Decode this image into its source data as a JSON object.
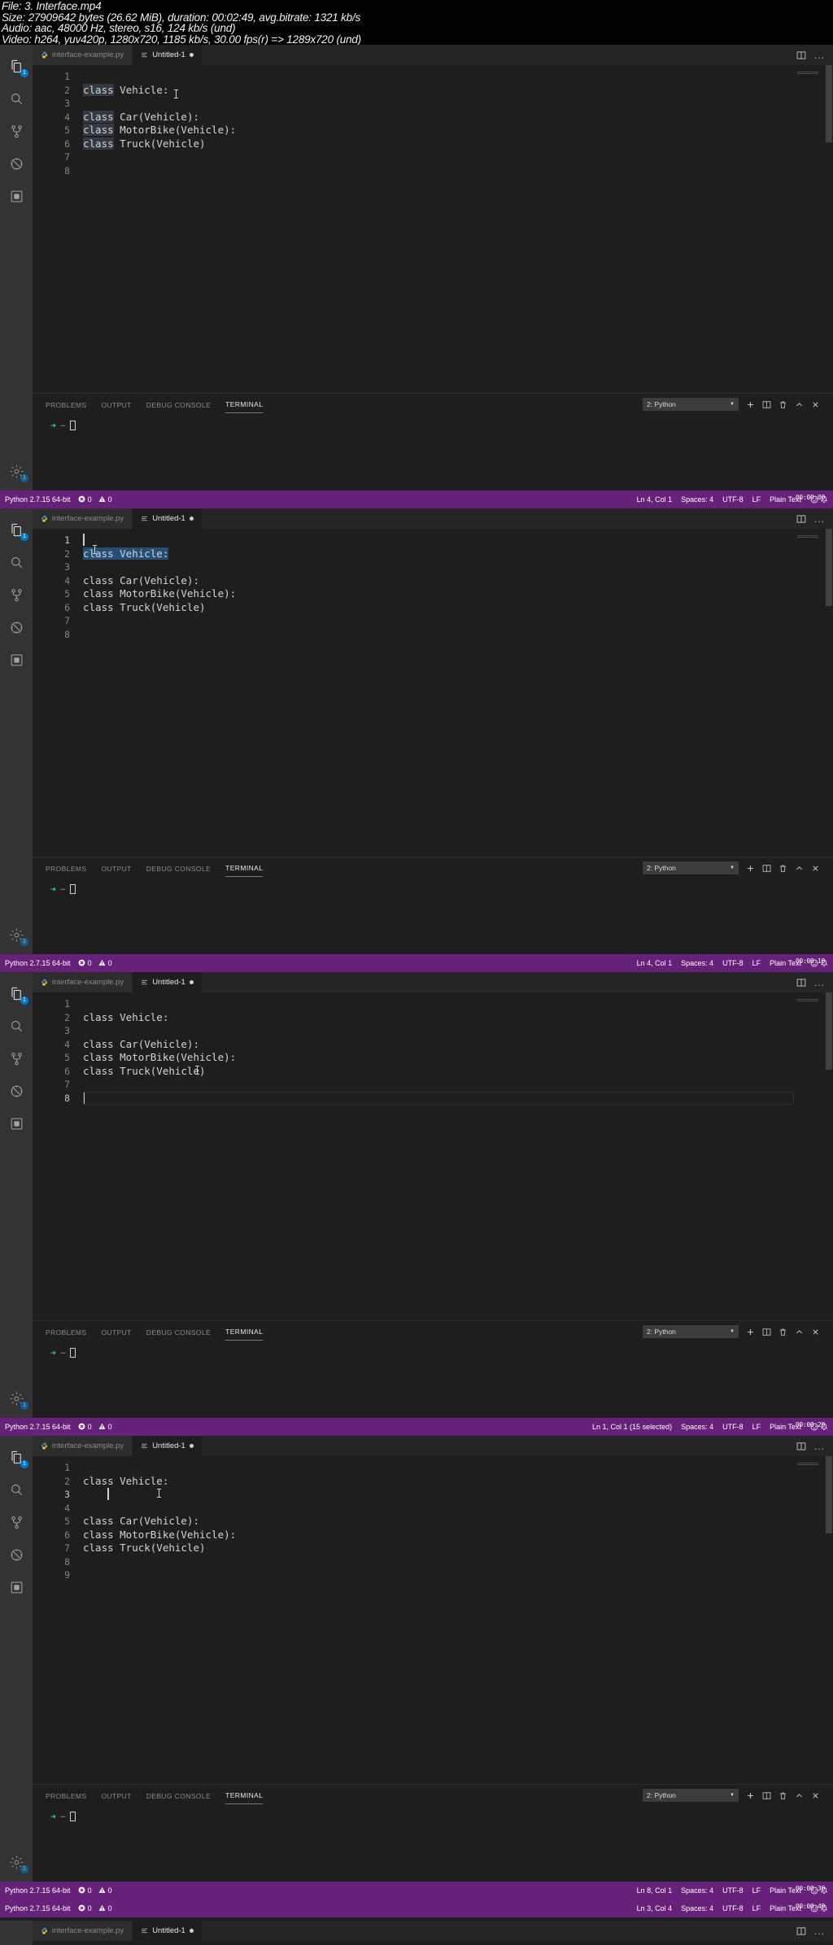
{
  "header": {
    "lines": [
      "File: 3. Interface.mp4",
      "Size: 27909642 bytes (26.62 MiB), duration: 00:02:49, avg.bitrate: 1321 kb/s",
      "Audio: aac, 48000 Hz, stereo, s16, 124 kb/s (und)",
      "Video: h264, yuv420p, 1280x720, 1185 kb/s, 30.00 fps(r) => 1289x720 (und)"
    ]
  },
  "activity_bar": {
    "items": [
      {
        "name": "explorer-icon",
        "badge": "1"
      },
      {
        "name": "search-icon",
        "badge": ""
      },
      {
        "name": "source-control-icon",
        "badge": ""
      },
      {
        "name": "run-debug-icon",
        "badge": ""
      },
      {
        "name": "extensions-icon",
        "badge": ""
      }
    ],
    "bottom": {
      "name": "settings-gear-icon",
      "badge": "1"
    }
  },
  "tabs": [
    {
      "label": "interface-example.py",
      "icon": "python-icon",
      "active": false,
      "dirty": false
    },
    {
      "label": "Untitled-1",
      "icon": "plaintext-icon",
      "active": true,
      "dirty": true
    }
  ],
  "tabbar_actions": {
    "split_editor": "split-editor-icon",
    "more_actions": "..."
  },
  "terminal_panel": {
    "tabs": [
      "PROBLEMS",
      "OUTPUT",
      "DEBUG CONSOLE",
      "TERMINAL"
    ],
    "active_tab": "TERMINAL",
    "select_value": "2: Python",
    "actions": [
      "new-terminal-icon",
      "split-terminal-icon",
      "kill-terminal-icon",
      "maximize-panel-icon",
      "close-panel-icon"
    ],
    "prompt_arrow": "➜",
    "prompt_tilde": "~"
  },
  "status_bar": {
    "python_version": "Python 2.7.15 64-bit",
    "errors": "0",
    "warnings": "0",
    "spaces": "Spaces: 4",
    "encoding": "UTF-8",
    "eol": "LF",
    "language": "Plain Text",
    "bg_color": "#68217a"
  },
  "frames": [
    {
      "id": "frame-1",
      "timestamp": "00:00:00",
      "cursor_position": "Ln 4, Col 1",
      "selection_info": "",
      "lines": [
        {
          "n": "1",
          "text": "",
          "style": "plain"
        },
        {
          "n": "2",
          "text": "class Vehicle:",
          "style": "kw-highlight"
        },
        {
          "n": "3",
          "text": "",
          "style": "plain"
        },
        {
          "n": "4",
          "text": "class Car(Vehicle):",
          "style": "kw-highlight"
        },
        {
          "n": "5",
          "text": "class MotorBike(Vehicle):",
          "style": "kw-highlight"
        },
        {
          "n": "6",
          "text": "class Truck(Vehicle)",
          "style": "kw-highlight"
        },
        {
          "n": "7",
          "text": "",
          "style": "plain"
        },
        {
          "n": "8",
          "text": "",
          "style": "plain"
        }
      ]
    },
    {
      "id": "frame-2",
      "timestamp": "00:00:10",
      "cursor_position": "Ln 4, Col 1",
      "selection_info": "",
      "lines": [
        {
          "n": "1",
          "text": "",
          "style": "caret"
        },
        {
          "n": "2",
          "text": "class Vehicle:",
          "style": "selected"
        },
        {
          "n": "3",
          "text": "",
          "style": "plain"
        },
        {
          "n": "4",
          "text": "class Car(Vehicle):",
          "style": "plain"
        },
        {
          "n": "5",
          "text": "class MotorBike(Vehicle):",
          "style": "plain"
        },
        {
          "n": "6",
          "text": "class Truck(Vehicle)",
          "style": "plain"
        },
        {
          "n": "7",
          "text": "",
          "style": "plain"
        },
        {
          "n": "8",
          "text": "",
          "style": "plain"
        }
      ]
    },
    {
      "id": "frame-3",
      "timestamp": "00:00:20",
      "cursor_position": "Ln 1, Col 1",
      "selection_info": "(15 selected)",
      "lines": [
        {
          "n": "1",
          "text": "",
          "style": "plain"
        },
        {
          "n": "2",
          "text": "class Vehicle:",
          "style": "plain"
        },
        {
          "n": "3",
          "text": "",
          "style": "plain"
        },
        {
          "n": "4",
          "text": "class Car(Vehicle):",
          "style": "plain"
        },
        {
          "n": "5",
          "text": "class MotorBike(Vehicle):",
          "style": "plain"
        },
        {
          "n": "6",
          "text": "class Truck(Vehicle)",
          "style": "plain"
        },
        {
          "n": "7",
          "text": "",
          "style": "plain"
        },
        {
          "n": "8",
          "text": "",
          "style": "current-line-caret"
        }
      ]
    },
    {
      "id": "frame-4",
      "timestamp": "00:00:30",
      "cursor_position": "Ln 8, Col 1",
      "selection_info": "",
      "lines": [
        {
          "n": "1",
          "text": "",
          "style": "plain"
        },
        {
          "n": "2",
          "text": "class Vehicle:",
          "style": "plain"
        },
        {
          "n": "3",
          "text": "    ",
          "style": "indent-caret"
        },
        {
          "n": "4",
          "text": "",
          "style": "plain"
        },
        {
          "n": "5",
          "text": "class Car(Vehicle):",
          "style": "plain"
        },
        {
          "n": "6",
          "text": "class MotorBike(Vehicle):",
          "style": "plain"
        },
        {
          "n": "7",
          "text": "class Truck(Vehicle)",
          "style": "plain"
        },
        {
          "n": "8",
          "text": "",
          "style": "plain"
        },
        {
          "n": "9",
          "text": "",
          "style": "plain"
        }
      ]
    },
    {
      "id": "frame-5",
      "timestamp": "00:00:40",
      "cursor_position": "Ln 3, Col 4",
      "selection_info": "",
      "lines": []
    }
  ]
}
